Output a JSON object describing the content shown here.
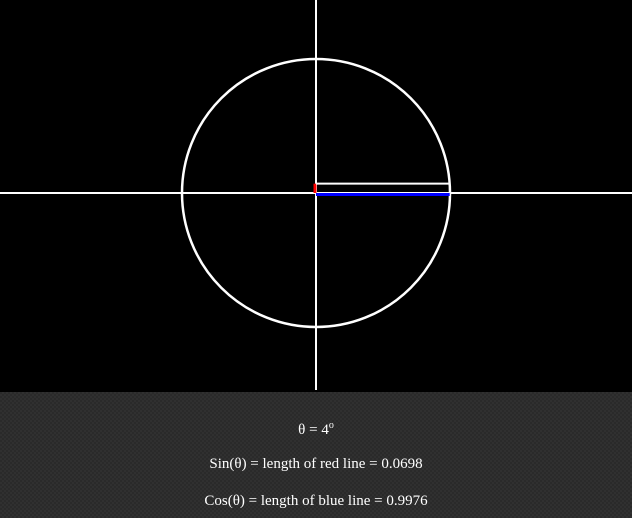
{
  "visualization": {
    "angle_degrees": 4,
    "sin_value": 0.0698,
    "cos_value": 0.9976,
    "colors": {
      "background": "#000000",
      "circle": "#ffffff",
      "axes": "#ffffff",
      "radius": "#ffffff",
      "sin_line": "#ff0000",
      "cos_line": "#0000ff"
    }
  },
  "readouts": {
    "theta_prefix": "θ = ",
    "theta_value": "4",
    "theta_unit": "o",
    "sin_text": "Sin(θ) = length of red line = 0.0698",
    "cos_text": "Cos(θ) = length of blue line = 0.9976"
  }
}
